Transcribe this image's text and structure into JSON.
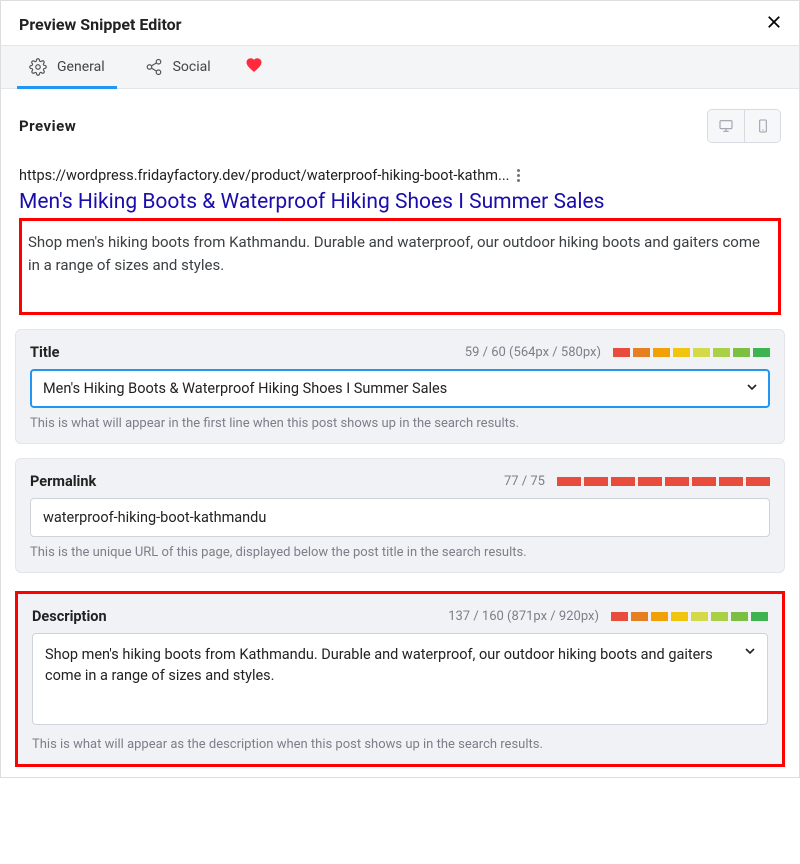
{
  "dialog": {
    "title": "Preview Snippet Editor"
  },
  "tabs": {
    "general": "General",
    "social": "Social"
  },
  "preview": {
    "heading": "Preview",
    "url": "https://wordpress.fridayfactory.dev/product/waterproof-hiking-boot-kathm...",
    "title": "Men's Hiking Boots & Waterproof Hiking Shoes I Summer Sales",
    "description": "Shop men's hiking boots from Kathmandu. Durable and waterproof, our outdoor hiking boots and gaiters come in a range of sizes and styles."
  },
  "title_field": {
    "label": "Title",
    "count": "59 / 60 (564px / 580px)",
    "value": "Men's Hiking Boots & Waterproof Hiking Shoes I Summer Sales",
    "help": "This is what will appear in the first line when this post shows up in the search results."
  },
  "permalink_field": {
    "label": "Permalink",
    "count": "77 / 75",
    "value": "waterproof-hiking-boot-kathmandu",
    "help": "This is the unique URL of this page, displayed below the post title in the search results."
  },
  "description_field": {
    "label": "Description",
    "count": "137 / 160 (871px / 920px)",
    "value": "Shop men's hiking boots from Kathmandu. Durable and waterproof, our outdoor hiking boots and gaiters come in a range of sizes and styles.",
    "help": "This is what will appear as the description when this post shows up in the search results."
  }
}
